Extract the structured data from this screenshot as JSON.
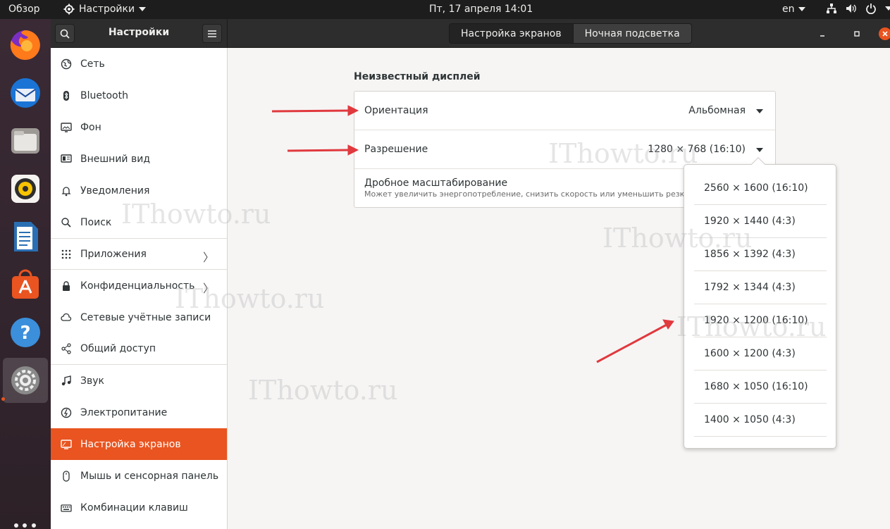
{
  "topbar": {
    "overview": "Обзор",
    "app_menu": "Настройки",
    "clock": "Пт, 17 апреля  14:01",
    "lang": "en"
  },
  "dock": {
    "items": [
      "firefox-icon",
      "thunderbird-icon",
      "files-icon",
      "rhythmbox-icon",
      "writer-icon",
      "software-icon",
      "help-icon",
      "settings-icon"
    ]
  },
  "header": {
    "title": "Настройки",
    "tabs": [
      "Настройка экранов",
      "Ночная подсветка"
    ]
  },
  "sidebar": {
    "items": [
      {
        "label": "Сеть",
        "icon": "network-icon"
      },
      {
        "label": "Bluetooth",
        "icon": "bluetooth-icon"
      },
      {
        "label": "Фон",
        "icon": "background-icon"
      },
      {
        "label": "Внешний вид",
        "icon": "appearance-icon"
      },
      {
        "label": "Уведомления",
        "icon": "bell-icon"
      },
      {
        "label": "Поиск",
        "icon": "search-icon"
      },
      {
        "label": "Приложения",
        "icon": "apps-icon"
      },
      {
        "label": "Конфиденциальность",
        "icon": "lock-icon"
      },
      {
        "label": "Сетевые учётные записи",
        "icon": "cloud-icon"
      },
      {
        "label": "Общий доступ",
        "icon": "share-icon"
      },
      {
        "label": "Звук",
        "icon": "music-icon"
      },
      {
        "label": "Электропитание",
        "icon": "power-icon"
      },
      {
        "label": "Настройка экранов",
        "icon": "display-icon"
      },
      {
        "label": "Мышь и сенсорная панель",
        "icon": "mouse-icon"
      },
      {
        "label": "Комбинации клавиш",
        "icon": "keyboard-icon"
      }
    ],
    "active_index": 12
  },
  "display": {
    "section_title": "Неизвестный дисплей",
    "orientation_label": "Ориентация",
    "orientation_value": "Альбомная",
    "resolution_label": "Разрешение",
    "resolution_value": "1280 × 768 (16:10)",
    "scaling_label": "Дробное масштабирование",
    "scaling_desc": "Может увеличить энергопотребление, снизить скорость или уменьшить резкость"
  },
  "resolutions": [
    "2560 × 1600 (16:10)",
    "1920 × 1440 (4:3)",
    "1856 × 1392 (4:3)",
    "1792 × 1344 (4:3)",
    "1920 × 1200 (16:10)",
    "1600 × 1200 (4:3)",
    "1680 × 1050 (16:10)",
    "1400 × 1050 (4:3)"
  ],
  "watermark": "IThowto.ru",
  "colors": {
    "accent": "#e95420",
    "arrow": "#e0393e"
  }
}
